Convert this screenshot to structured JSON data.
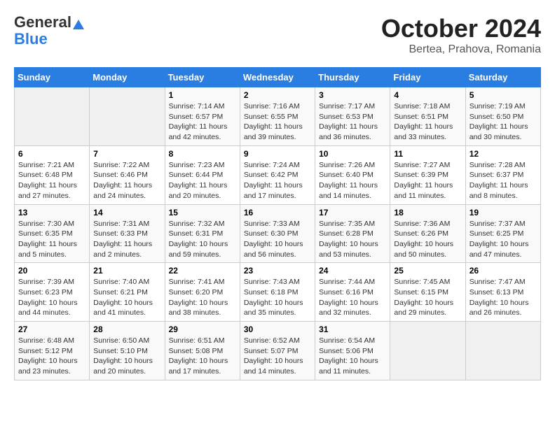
{
  "header": {
    "logo_general": "General",
    "logo_blue": "Blue",
    "month_title": "October 2024",
    "location": "Bertea, Prahova, Romania"
  },
  "weekdays": [
    "Sunday",
    "Monday",
    "Tuesday",
    "Wednesday",
    "Thursday",
    "Friday",
    "Saturday"
  ],
  "weeks": [
    [
      {
        "day": "",
        "sunrise": "",
        "sunset": "",
        "daylight": ""
      },
      {
        "day": "",
        "sunrise": "",
        "sunset": "",
        "daylight": ""
      },
      {
        "day": "1",
        "sunrise": "Sunrise: 7:14 AM",
        "sunset": "Sunset: 6:57 PM",
        "daylight": "Daylight: 11 hours and 42 minutes."
      },
      {
        "day": "2",
        "sunrise": "Sunrise: 7:16 AM",
        "sunset": "Sunset: 6:55 PM",
        "daylight": "Daylight: 11 hours and 39 minutes."
      },
      {
        "day": "3",
        "sunrise": "Sunrise: 7:17 AM",
        "sunset": "Sunset: 6:53 PM",
        "daylight": "Daylight: 11 hours and 36 minutes."
      },
      {
        "day": "4",
        "sunrise": "Sunrise: 7:18 AM",
        "sunset": "Sunset: 6:51 PM",
        "daylight": "Daylight: 11 hours and 33 minutes."
      },
      {
        "day": "5",
        "sunrise": "Sunrise: 7:19 AM",
        "sunset": "Sunset: 6:50 PM",
        "daylight": "Daylight: 11 hours and 30 minutes."
      }
    ],
    [
      {
        "day": "6",
        "sunrise": "Sunrise: 7:21 AM",
        "sunset": "Sunset: 6:48 PM",
        "daylight": "Daylight: 11 hours and 27 minutes."
      },
      {
        "day": "7",
        "sunrise": "Sunrise: 7:22 AM",
        "sunset": "Sunset: 6:46 PM",
        "daylight": "Daylight: 11 hours and 24 minutes."
      },
      {
        "day": "8",
        "sunrise": "Sunrise: 7:23 AM",
        "sunset": "Sunset: 6:44 PM",
        "daylight": "Daylight: 11 hours and 20 minutes."
      },
      {
        "day": "9",
        "sunrise": "Sunrise: 7:24 AM",
        "sunset": "Sunset: 6:42 PM",
        "daylight": "Daylight: 11 hours and 17 minutes."
      },
      {
        "day": "10",
        "sunrise": "Sunrise: 7:26 AM",
        "sunset": "Sunset: 6:40 PM",
        "daylight": "Daylight: 11 hours and 14 minutes."
      },
      {
        "day": "11",
        "sunrise": "Sunrise: 7:27 AM",
        "sunset": "Sunset: 6:39 PM",
        "daylight": "Daylight: 11 hours and 11 minutes."
      },
      {
        "day": "12",
        "sunrise": "Sunrise: 7:28 AM",
        "sunset": "Sunset: 6:37 PM",
        "daylight": "Daylight: 11 hours and 8 minutes."
      }
    ],
    [
      {
        "day": "13",
        "sunrise": "Sunrise: 7:30 AM",
        "sunset": "Sunset: 6:35 PM",
        "daylight": "Daylight: 11 hours and 5 minutes."
      },
      {
        "day": "14",
        "sunrise": "Sunrise: 7:31 AM",
        "sunset": "Sunset: 6:33 PM",
        "daylight": "Daylight: 11 hours and 2 minutes."
      },
      {
        "day": "15",
        "sunrise": "Sunrise: 7:32 AM",
        "sunset": "Sunset: 6:31 PM",
        "daylight": "Daylight: 10 hours and 59 minutes."
      },
      {
        "day": "16",
        "sunrise": "Sunrise: 7:33 AM",
        "sunset": "Sunset: 6:30 PM",
        "daylight": "Daylight: 10 hours and 56 minutes."
      },
      {
        "day": "17",
        "sunrise": "Sunrise: 7:35 AM",
        "sunset": "Sunset: 6:28 PM",
        "daylight": "Daylight: 10 hours and 53 minutes."
      },
      {
        "day": "18",
        "sunrise": "Sunrise: 7:36 AM",
        "sunset": "Sunset: 6:26 PM",
        "daylight": "Daylight: 10 hours and 50 minutes."
      },
      {
        "day": "19",
        "sunrise": "Sunrise: 7:37 AM",
        "sunset": "Sunset: 6:25 PM",
        "daylight": "Daylight: 10 hours and 47 minutes."
      }
    ],
    [
      {
        "day": "20",
        "sunrise": "Sunrise: 7:39 AM",
        "sunset": "Sunset: 6:23 PM",
        "daylight": "Daylight: 10 hours and 44 minutes."
      },
      {
        "day": "21",
        "sunrise": "Sunrise: 7:40 AM",
        "sunset": "Sunset: 6:21 PM",
        "daylight": "Daylight: 10 hours and 41 minutes."
      },
      {
        "day": "22",
        "sunrise": "Sunrise: 7:41 AM",
        "sunset": "Sunset: 6:20 PM",
        "daylight": "Daylight: 10 hours and 38 minutes."
      },
      {
        "day": "23",
        "sunrise": "Sunrise: 7:43 AM",
        "sunset": "Sunset: 6:18 PM",
        "daylight": "Daylight: 10 hours and 35 minutes."
      },
      {
        "day": "24",
        "sunrise": "Sunrise: 7:44 AM",
        "sunset": "Sunset: 6:16 PM",
        "daylight": "Daylight: 10 hours and 32 minutes."
      },
      {
        "day": "25",
        "sunrise": "Sunrise: 7:45 AM",
        "sunset": "Sunset: 6:15 PM",
        "daylight": "Daylight: 10 hours and 29 minutes."
      },
      {
        "day": "26",
        "sunrise": "Sunrise: 7:47 AM",
        "sunset": "Sunset: 6:13 PM",
        "daylight": "Daylight: 10 hours and 26 minutes."
      }
    ],
    [
      {
        "day": "27",
        "sunrise": "Sunrise: 6:48 AM",
        "sunset": "Sunset: 5:12 PM",
        "daylight": "Daylight: 10 hours and 23 minutes."
      },
      {
        "day": "28",
        "sunrise": "Sunrise: 6:50 AM",
        "sunset": "Sunset: 5:10 PM",
        "daylight": "Daylight: 10 hours and 20 minutes."
      },
      {
        "day": "29",
        "sunrise": "Sunrise: 6:51 AM",
        "sunset": "Sunset: 5:08 PM",
        "daylight": "Daylight: 10 hours and 17 minutes."
      },
      {
        "day": "30",
        "sunrise": "Sunrise: 6:52 AM",
        "sunset": "Sunset: 5:07 PM",
        "daylight": "Daylight: 10 hours and 14 minutes."
      },
      {
        "day": "31",
        "sunrise": "Sunrise: 6:54 AM",
        "sunset": "Sunset: 5:06 PM",
        "daylight": "Daylight: 10 hours and 11 minutes."
      },
      {
        "day": "",
        "sunrise": "",
        "sunset": "",
        "daylight": ""
      },
      {
        "day": "",
        "sunrise": "",
        "sunset": "",
        "daylight": ""
      }
    ]
  ]
}
